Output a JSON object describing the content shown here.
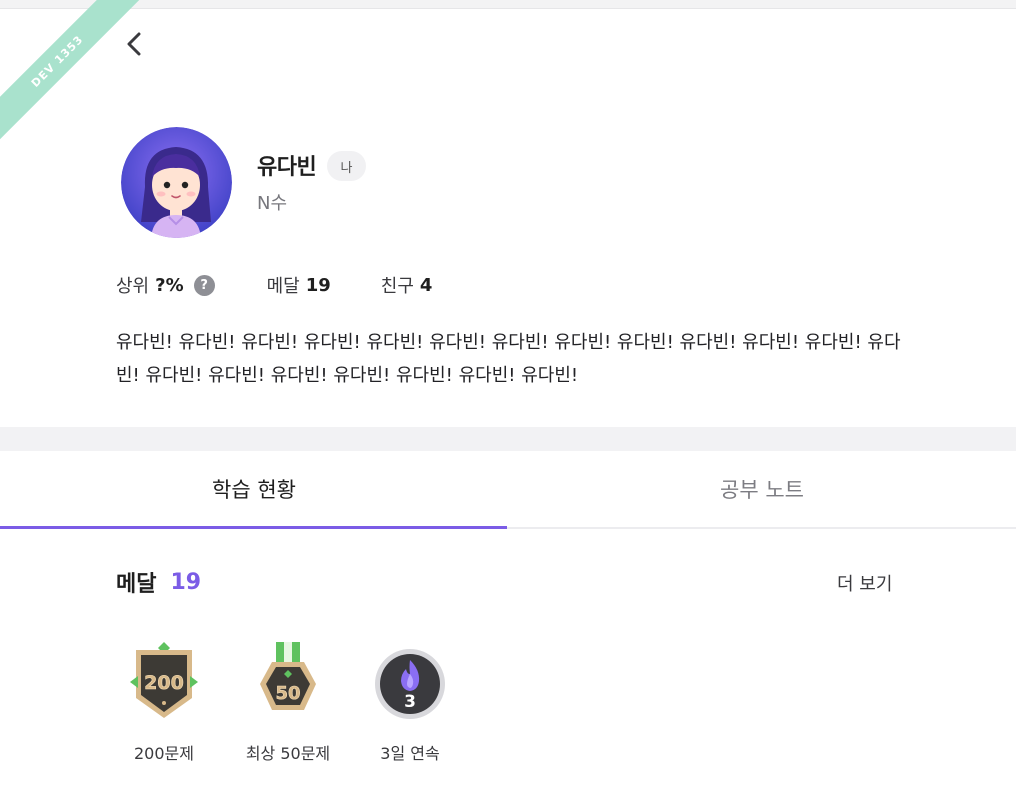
{
  "ribbon": {
    "text": "DEV 1353"
  },
  "profile": {
    "name": "유다빈",
    "me_badge": "나",
    "status": "N수"
  },
  "stats": {
    "rank_label": "상위",
    "rank_value": "?%",
    "medal_label": "메달",
    "medal_value": "19",
    "friend_label": "친구",
    "friend_value": "4"
  },
  "bio": "유다빈! 유다빈! 유다빈! 유다빈! 유다빈! 유다빈! 유다빈! 유다빈! 유다빈! 유다빈! 유다빈! 유다빈! 유다빈! 유다빈! 유다빈! 유다빈! 유다빈! 유다빈! 유다빈! 유다빈!",
  "tabs": [
    {
      "label": "학습 현황",
      "active": true
    },
    {
      "label": "공부 노트",
      "active": false
    }
  ],
  "medals_section": {
    "title": "메달",
    "count": "19",
    "more_label": "더 보기",
    "items": [
      {
        "badge_text": "200",
        "label": "200문제",
        "icon": "shield-medal-icon"
      },
      {
        "badge_text": "50",
        "label": "최상 50문제",
        "icon": "ribbon-medal-icon"
      },
      {
        "badge_text": "3",
        "label": "3일 연속",
        "icon": "flame-streak-icon"
      }
    ]
  },
  "colors": {
    "accent": "#7b5ce6",
    "ribbon": "#a9e2cd",
    "medal_dark": "#3d3a35",
    "medal_gold": "#d8b98a",
    "medal_green": "#5fc25f"
  }
}
